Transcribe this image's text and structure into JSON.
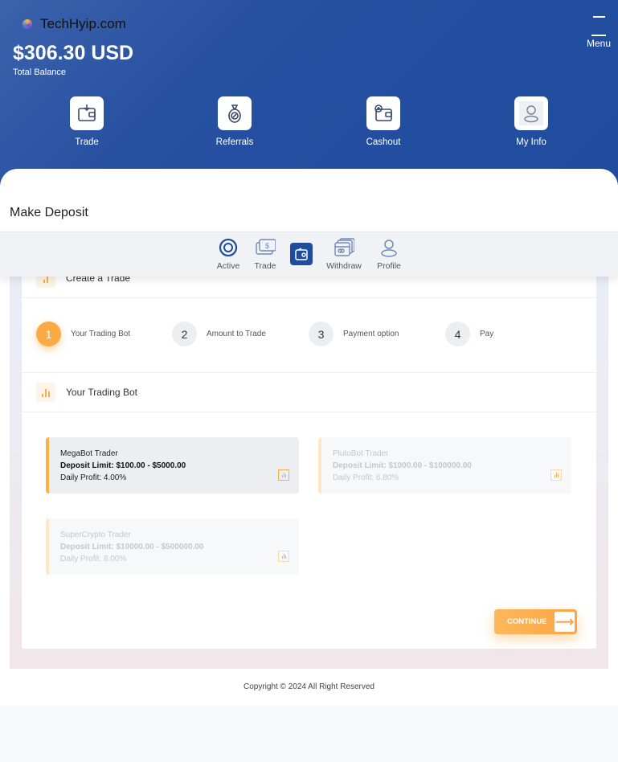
{
  "header": {
    "brand": "TechHyip.com",
    "balance": "$306.30 USD",
    "balance_label": "Total Balance",
    "menu_label": "Menu"
  },
  "quick_actions": [
    {
      "label": "Trade",
      "icon": "wallet-download-icon"
    },
    {
      "label": "Referrals",
      "icon": "money-bag-percent-icon"
    },
    {
      "label": "Cashout",
      "icon": "wallet-plus-icon"
    },
    {
      "label": "My Info",
      "icon": "user-icon"
    }
  ],
  "page_title": "Make Deposit",
  "bottom_nav": [
    {
      "label": "Active",
      "icon": "circle-icon"
    },
    {
      "label": "Trade",
      "icon": "cash-icon"
    },
    {
      "label": "",
      "icon": "wallet-icon",
      "active": true
    },
    {
      "label": "Withdraw",
      "icon": "cards-icon"
    },
    {
      "label": "Profile",
      "icon": "user-icon"
    }
  ],
  "card": {
    "heading": "Create a Trade",
    "steps": [
      {
        "num": "1",
        "label": "Your Trading Bot",
        "active": true
      },
      {
        "num": "2",
        "label": "Amount to Trade"
      },
      {
        "num": "3",
        "label": "Payment option"
      },
      {
        "num": "4",
        "label": "Pay"
      }
    ],
    "section_title": "Your Trading Bot",
    "bots": [
      {
        "name": "MegaBot Trader",
        "limit": "Deposit Limit: $100.00 - $5000.00",
        "profit": "Daily Profit: 4.00%",
        "selected": true
      },
      {
        "name": "PlutoBot Trader",
        "limit": "Deposit Limit: $1000.00 - $100000.00",
        "profit": "Daily Profit: 6.80%"
      },
      {
        "name": "SuperCrypto Trader",
        "limit": "Deposit Limit: $10000.00 - $500000.00",
        "profit": "Daily Profit: 8.00%"
      }
    ],
    "continue_label": "CONTINUE"
  },
  "footer": {
    "copyright": "Copyright © 2024 All Right Reserved"
  },
  "colors": {
    "header": "#2650a0",
    "accent": "#fcaa45",
    "nav_active": "#1f4c9e"
  }
}
